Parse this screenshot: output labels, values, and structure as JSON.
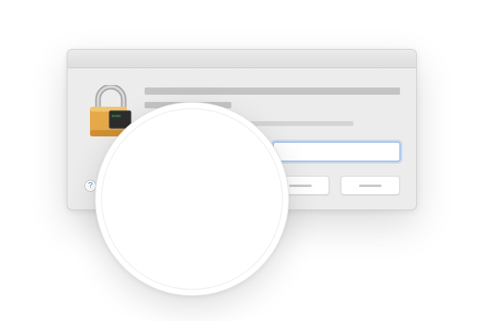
{
  "dialog": {
    "help_glyph": "?",
    "lock_icon": "padlock-with-terminal-icon",
    "lock_label": "exec"
  },
  "colors": {
    "window_bg": "#ececec",
    "titlebar": "#dedede",
    "placeholder": "#c4c4c4",
    "focus_ring": "#a8c6ec",
    "help_accent": "#4a8fe2",
    "lock_body": "#e6a94a"
  }
}
